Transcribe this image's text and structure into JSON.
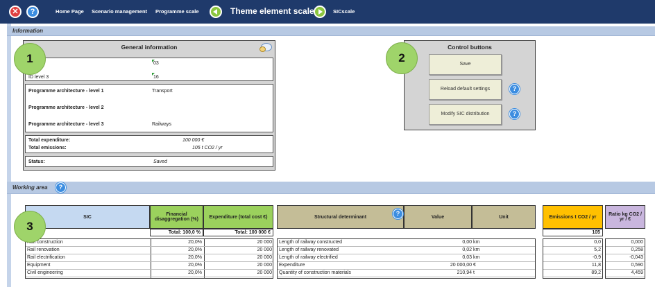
{
  "nav": {
    "home": "Home Page",
    "scenario": "Scenario management",
    "programme": "Programme scale",
    "theme": "Theme element scale",
    "sic": "SICscale"
  },
  "information": {
    "section_label": "Information",
    "general_title": "General information",
    "id_value_1": "03",
    "id_label_3": "ID level 3",
    "id_value_3": "16",
    "arch1_label": "Programme architecture - level 1",
    "arch1_value": "Transport",
    "arch2_label": "Programme architecture - level 2",
    "arch2_value": "",
    "arch3_label": "Programme architecture - level 3",
    "arch3_value": "Railways",
    "exp_label": "Total expenditure:",
    "exp_value": "100 000  €",
    "emis_label": "Total emissions:",
    "emis_value": "105  t CO2 / yr",
    "status_label": "Status:",
    "status_value": "Saved"
  },
  "control": {
    "title": "Control buttons",
    "save": "Save",
    "reload": "Reload default settings",
    "modify": "Modify SIC distribution"
  },
  "badges": [
    "1",
    "2",
    "3"
  ],
  "working_area": {
    "section_label": "Working area"
  },
  "table": {
    "headers": {
      "sic": "SIC",
      "fin": "Financial disaggregation (%)",
      "exp": "Expenditure (total cost €)",
      "struct": "Structural determinant",
      "value": "Value",
      "unit": "Unit",
      "emis": "Emissions t CO2 / yr",
      "ratio": "Ratio kg CO2 / yr / €"
    },
    "totals": {
      "fin": "Total: 100,0 %",
      "exp": "Total: 100 000 €",
      "emis": "105"
    },
    "rows": [
      {
        "sic": "Rail construction",
        "fin": "20,0%",
        "exp": "20 000",
        "struct": "Length of railway constructed",
        "value": "0,00",
        "unit": "km",
        "emis": "0,0",
        "ratio": "0,000"
      },
      {
        "sic": "Rail renovation",
        "fin": "20,0%",
        "exp": "20 000",
        "struct": "Length of railway renovated",
        "value": "0,02",
        "unit": "km",
        "emis": "5,2",
        "ratio": "0,258"
      },
      {
        "sic": "Rail electrification",
        "fin": "20,0%",
        "exp": "20 000",
        "struct": "Length of railway electrified",
        "value": "0,03",
        "unit": "km",
        "emis": "-0,9",
        "ratio": "-0,043"
      },
      {
        "sic": "Equipment",
        "fin": "20,0%",
        "exp": "20 000",
        "struct": "Expenditure",
        "value": "20 000,00",
        "unit": "€",
        "emis": "11,8",
        "ratio": "0,590"
      },
      {
        "sic": "Civil engineering",
        "fin": "20,0%",
        "exp": "20 000",
        "struct": "Quantity of construction materials",
        "value": "210,94",
        "unit": "t",
        "emis": "89,2",
        "ratio": "4,459"
      }
    ]
  }
}
